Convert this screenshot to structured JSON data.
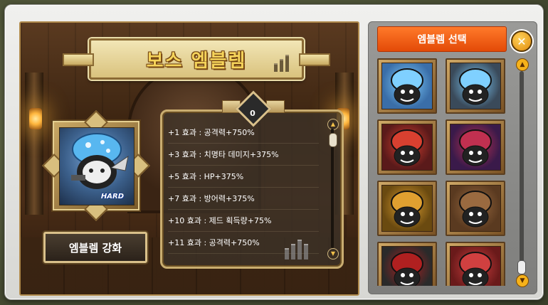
{
  "title": "보스 엠블렘",
  "emblem": {
    "badge": "HARD"
  },
  "upgrade_button": "엠블렘 강화",
  "effects": {
    "level": "0",
    "rows": [
      "+1 효과 : 공격력+750%",
      "+3 효과 : 치명타 데미지+375%",
      "+5 효과 : HP+375%",
      "+7 효과 : 방어력+375%",
      "+10 효과 : 제드 획득량+75%",
      "+11 효과 : 공격력+750%"
    ]
  },
  "selector": {
    "header": "엠블렘 선택",
    "close_icon": "close-icon",
    "emblems": [
      {
        "name": "blue-mushroom-emblem",
        "bg": "#3a6ea8",
        "accent": "#7fd0ff"
      },
      {
        "name": "blue-mushroom-emblem-alt",
        "bg": "#3a4a5a",
        "accent": "#7fd0ff"
      },
      {
        "name": "red-knight-emblem",
        "bg": "#5a1a1a",
        "accent": "#d84030"
      },
      {
        "name": "purple-knight-emblem",
        "bg": "#3a1a4a",
        "accent": "#c03050"
      },
      {
        "name": "golden-knight-emblem",
        "bg": "#6a4a10",
        "accent": "#e0a030"
      },
      {
        "name": "brown-ogre-emblem",
        "bg": "#5a3a20",
        "accent": "#9a6a40"
      },
      {
        "name": "black-ogre-emblem",
        "bg": "#2a2a2a",
        "accent": "#b02020"
      },
      {
        "name": "red-ogre-emblem",
        "bg": "#6a1a1a",
        "accent": "#d04040"
      }
    ]
  }
}
